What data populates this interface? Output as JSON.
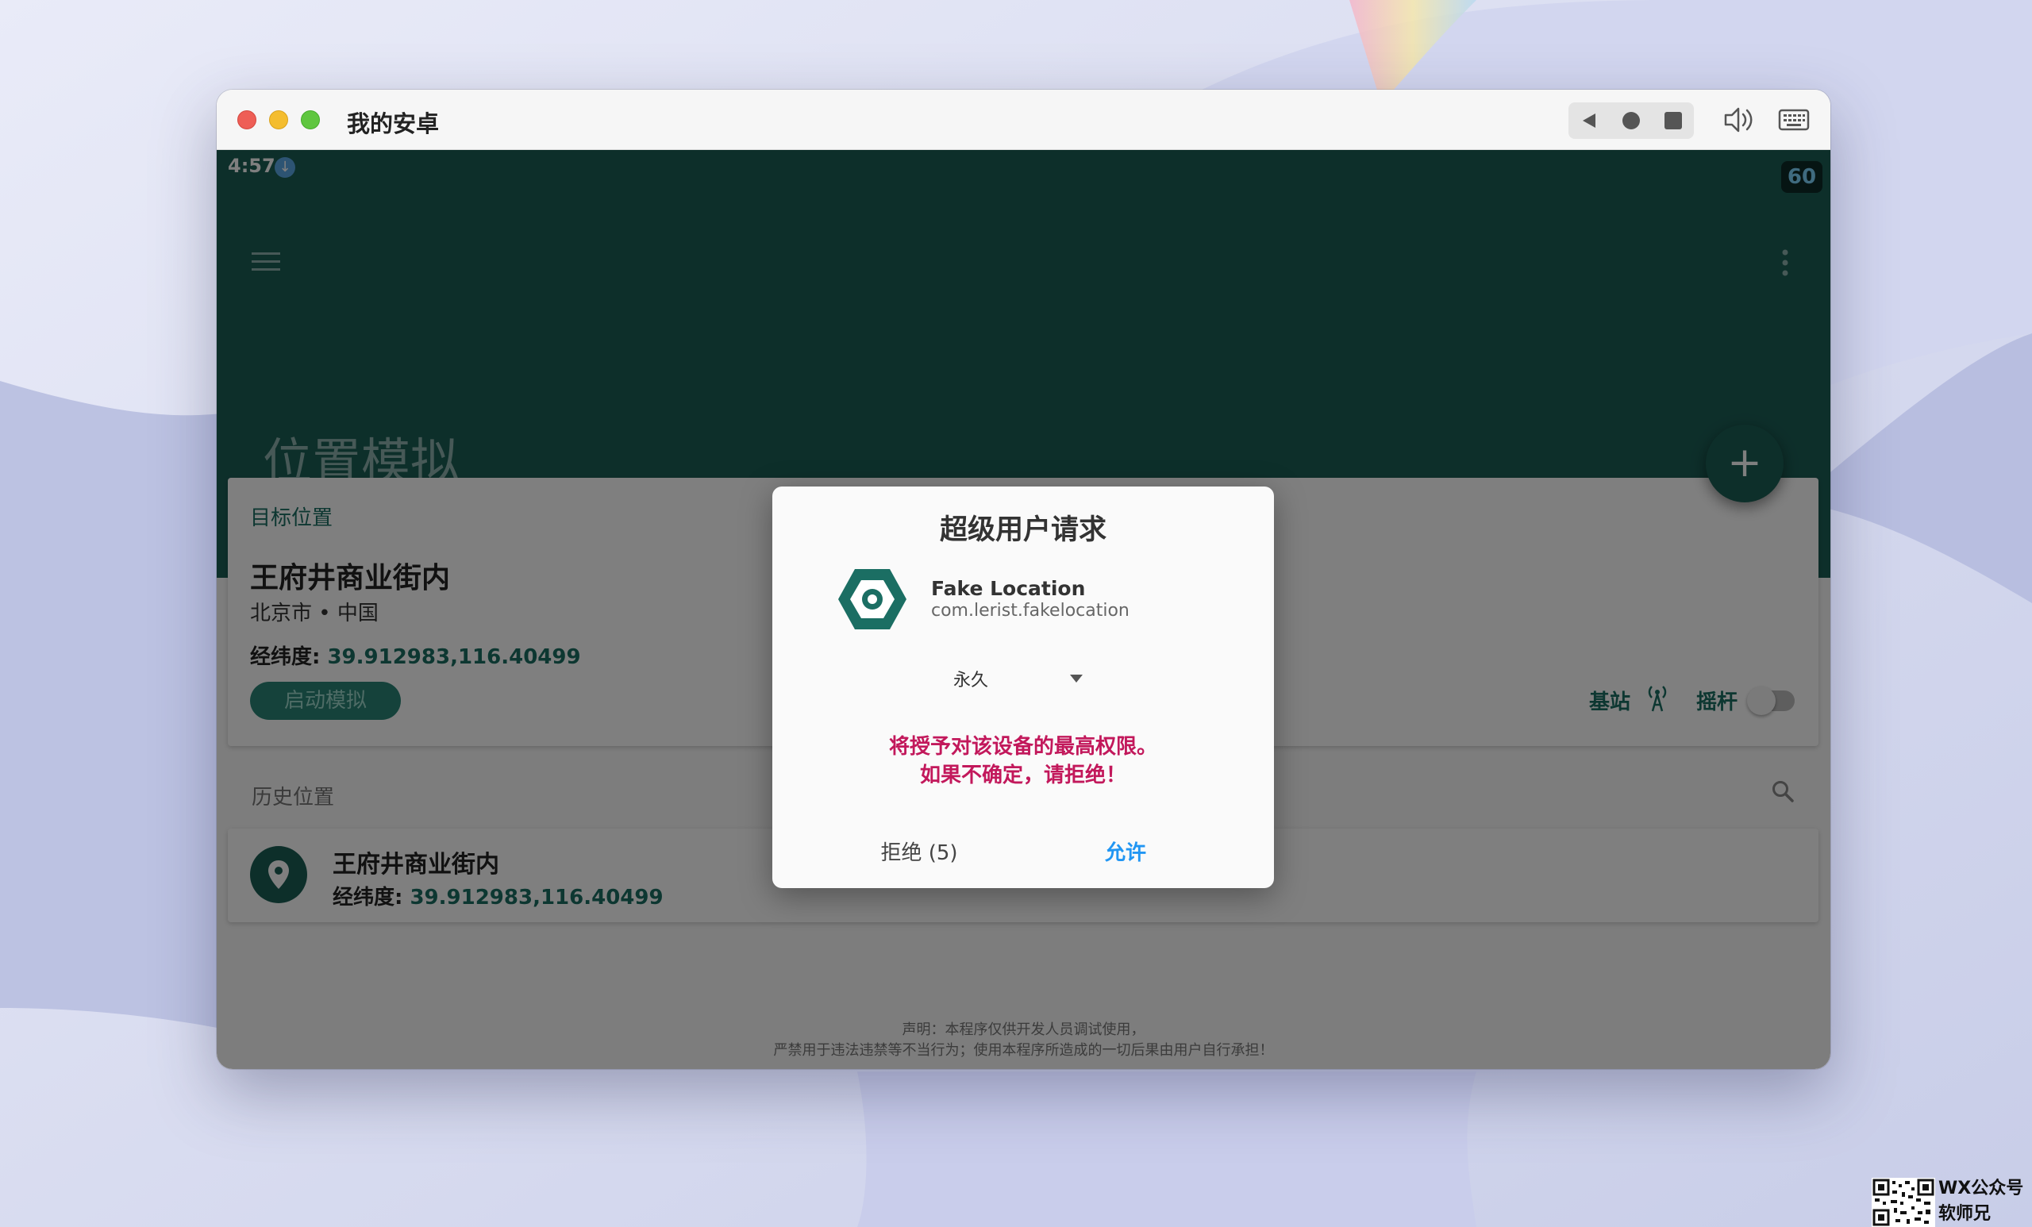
{
  "window": {
    "title": "我的安卓"
  },
  "colors": {
    "primary": "#1b5e55",
    "accent": "#2196f3",
    "warning": "#c2185b"
  },
  "statusbar": {
    "time": "4:57",
    "fps": "60",
    "icons": [
      "download-icon"
    ]
  },
  "appbar": {
    "title": "位置模拟",
    "menu_icon": "hamburger-menu-icon",
    "more_icon": "more-vertical-icon"
  },
  "target": {
    "label": "目标位置",
    "name": "王府井商业街内",
    "city": "北京市 • 中国",
    "coord_label": "经纬度:",
    "coord_value": "39.912983,116.40499",
    "start_button": "启动模拟",
    "option_base": "基站",
    "option_joystick": "摇杆",
    "joystick_enabled": false
  },
  "history": {
    "title": "历史位置",
    "items": [
      {
        "name": "王府井商业街内",
        "coord_label": "经纬度:",
        "coord_value": "39.912983,116.40499"
      }
    ]
  },
  "disclaimer": {
    "line1": "声明：本程序仅供开发人员调试使用，",
    "line2": "严禁用于违法违禁等不当行为；使用本程序所造成的一切后果由用户自行承担！"
  },
  "dialog": {
    "title": "超级用户请求",
    "app_name": "Fake Location",
    "app_package": "com.lerist.fakelocation",
    "duration_value": "永久",
    "warning_line1": "将授予对该设备的最高权限。",
    "warning_line2": "如果不确定，请拒绝！",
    "deny_label": "拒绝 (5)",
    "allow_label": "允许"
  },
  "watermark": {
    "line1": "WX公众号",
    "line2": "软师兄"
  }
}
